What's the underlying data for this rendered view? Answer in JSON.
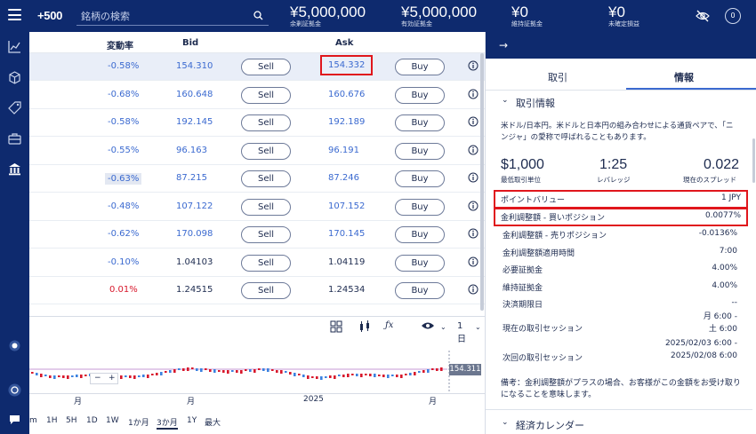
{
  "topbar": {
    "logo": "+500",
    "search_placeholder": "銘柄の検索",
    "stats": [
      {
        "value": "¥5,000,000",
        "label": "余剰証拠金"
      },
      {
        "value": "¥5,000,000",
        "label": "有効証拠金"
      },
      {
        "value": "¥0",
        "label": "維持証拠金"
      },
      {
        "value": "¥0",
        "label": "未確定損益"
      }
    ],
    "avatar_text": "0"
  },
  "table": {
    "headers": {
      "change": "変動率",
      "bid": "Bid",
      "ask": "Ask"
    },
    "sell_label": "Sell",
    "buy_label": "Buy",
    "rows": [
      {
        "change": "-0.58%",
        "bid": "154.310",
        "ask": "154.332"
      },
      {
        "change": "-0.68%",
        "bid": "160.648",
        "ask": "160.676"
      },
      {
        "change": "-0.58%",
        "bid": "192.145",
        "ask": "192.189"
      },
      {
        "change": "-0.55%",
        "bid": "96.163",
        "ask": "96.191"
      },
      {
        "change": "-0.63%",
        "bid": "87.215",
        "ask": "87.246"
      },
      {
        "change": "-0.48%",
        "bid": "107.122",
        "ask": "107.152"
      },
      {
        "change": "-0.62%",
        "bid": "170.098",
        "ask": "170.145"
      },
      {
        "change": "-0.10%",
        "bid": "1.04103",
        "ask": "1.04119"
      },
      {
        "change": "0.01%",
        "bid": "1.24515",
        "ask": "1.24534"
      }
    ]
  },
  "chart": {
    "price_tag": "154.311",
    "interval": "1日",
    "zoom_minus": "−",
    "zoom_plus": "+",
    "x_labels": [
      "月",
      "月",
      "2025",
      "月"
    ],
    "timeframes": [
      "m",
      "1H",
      "5H",
      "1D",
      "1W",
      "1か月",
      "3か月",
      "1Y",
      "最大"
    ],
    "active_timeframe": "3か月"
  },
  "panel": {
    "tabs": [
      "取引",
      "情報"
    ],
    "section_title": "取引情報",
    "description": "米ドル/日本円。米ドルと日本円の組み合わせによる通貨ペアで、「ニンジャ」の愛称で呼ばれることもあります。",
    "metrics": [
      {
        "value": "$1,000",
        "label": "最低取引単位"
      },
      {
        "value": "1:25",
        "label": "レバレッジ"
      },
      {
        "value": "0.022",
        "label": "現在のスプレッド"
      }
    ],
    "details": [
      {
        "key": "ポイントバリュー",
        "value": "1 JPY"
      },
      {
        "key": "金利調整額 - 買いポジション",
        "value": "0.0077%"
      },
      {
        "key": "金利調整額 - 売りポジション",
        "value": "-0.0136%"
      },
      {
        "key": "金利調整額適用時間",
        "value": "7:00"
      },
      {
        "key": "必要証拠金",
        "value": "4.00%"
      },
      {
        "key": "維持証拠金",
        "value": "4.00%"
      },
      {
        "key": "決済期限日",
        "value": "--"
      }
    ],
    "session_current": {
      "key": "現在の取引セッション",
      "line1": "月 6:00 -",
      "line2": "土 6:00"
    },
    "session_next": {
      "key": "次回の取引セッション",
      "line1": "2025/02/03 6:00 -",
      "line2": "2025/02/08 6:00"
    },
    "note": "備考：金利調整額がプラスの場合、お客様がこの金額をお受け取りになることを意味します。",
    "calendar_title": "経済カレンダー"
  },
  "colors": {
    "navy": "#0e2a6e",
    "accent": "#3b6ad0",
    "highlight": "#e0161c"
  }
}
